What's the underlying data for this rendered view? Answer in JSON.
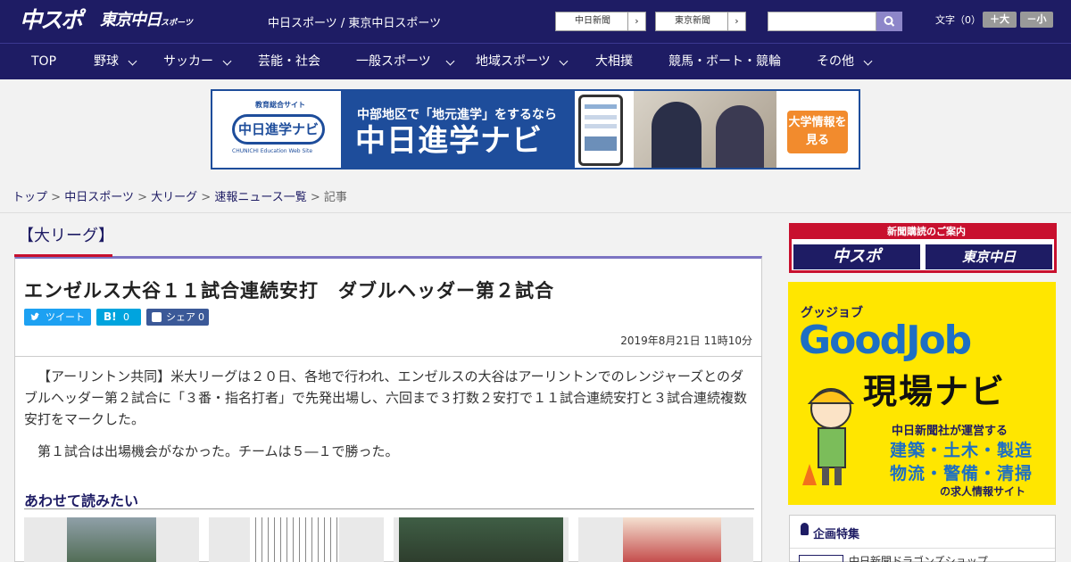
{
  "header": {
    "logo_main": "中スポ",
    "logo_sub": "東京中日",
    "logo_sub_small": "スポーツ",
    "site_title": "中日スポーツ / 東京中日スポーツ",
    "paper_links": [
      {
        "label": "中日新聞"
      },
      {
        "label": "東京新聞"
      }
    ],
    "font_size_label": "文字（0）",
    "font_up": "＋大",
    "font_down": "－小",
    "search_placeholder": ""
  },
  "nav": {
    "items": [
      {
        "label": "TOP"
      },
      {
        "label": "野球"
      },
      {
        "label": "サッカー"
      },
      {
        "label": "芸能・社会"
      },
      {
        "label": "一般スポーツ"
      },
      {
        "label": "地域スポーツ"
      },
      {
        "label": "大相撲"
      },
      {
        "label": "競馬・ボート・競輪"
      },
      {
        "label": "その他"
      }
    ]
  },
  "banner": {
    "left_caption": "教育総合サイト",
    "left_logo": "中日進学ナビ",
    "left_sub": "CHUNICHI Education Web Site",
    "tagline": "中部地区で「地元進学」をするなら",
    "main": "中日進学ナビ",
    "cta": "大学情報を見る"
  },
  "breadcrumb": {
    "items": [
      "トップ",
      "中日スポーツ",
      "大リーグ",
      "速報ニュース一覧"
    ],
    "current": "記事",
    "separator": ">"
  },
  "article": {
    "category": "【大リーグ】",
    "headline": "エンゼルス大谷１１試合連続安打　ダブルヘッダー第２試合",
    "share": {
      "tweet": "ツイート",
      "hatena": "B!",
      "hatena_count": "0",
      "fb": "シェア",
      "fb_count": "0"
    },
    "date": "2019年8月21日 11時10分",
    "paragraphs": [
      "【アーリントン共同】米大リーグは２０日、各地で行われ、エンゼルスの大谷はアーリントンでのレンジャーズとのダブルヘッダー第２試合に「３番・指名打者」で先発出場し、六回まで３打数２安打で１１試合連続安打と３試合連続複数安打をマークした。",
      "第１試合は出場機会がなかった。チームは５―１で勝った。"
    ],
    "related_title": "あわせて読みたい"
  },
  "aside": {
    "subscribe_head": "新聞購読のご案内",
    "subscribe_logos": [
      "中スポ",
      "東京中日"
    ],
    "ad": {
      "small": "グッジョブ",
      "brand": "GoodJob",
      "title": "現場ナビ",
      "operator": "中日新聞社が運営する",
      "line1": "建築・土木・製造",
      "line2": "物流・警備・清掃",
      "footer": "の求人情報サイト"
    },
    "special_title": "企画特集",
    "special_item": "中日新聞ドラゴンズショップ"
  },
  "colors": {
    "brand_navy": "#1e1c64",
    "accent_red": "#c8102e",
    "accent_purple": "#7c74c2",
    "ad_yellow": "#ffe600"
  }
}
